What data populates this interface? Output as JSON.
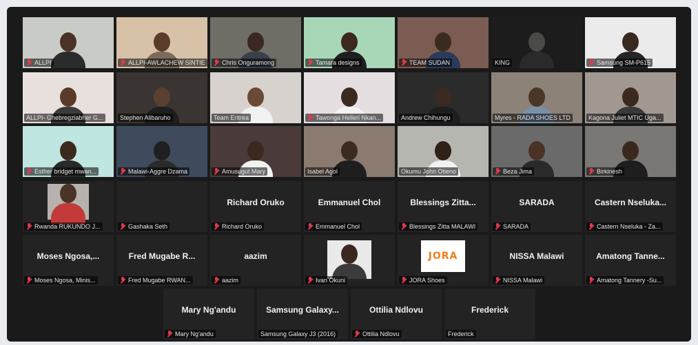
{
  "colors": {
    "active_border": "#e8e34a",
    "mic_muted": "#e2394b",
    "tile_bg": "#232323"
  },
  "rows": [
    {
      "tiles": [
        {
          "label": "ALLPI",
          "muted": true,
          "video": true,
          "bg": "#c9cbc7",
          "skin": "#4a3326",
          "shirt": "#2b2b2b"
        },
        {
          "label": "ALLPI-AWLACHEW SINTIE",
          "muted": true,
          "video": true,
          "bg": "#d7c2a7",
          "skin": "#5b3c2a",
          "shirt": "#7a6a5a"
        },
        {
          "label": "Chris Onguramong",
          "muted": true,
          "video": true,
          "bg": "#6e6e66",
          "skin": "#3b2820",
          "shirt": "#3a3f4c"
        },
        {
          "label": "Tamara designs",
          "muted": true,
          "video": true,
          "bg": "#a8d7b8",
          "skin": "#3c281e",
          "shirt": "#1f1f1f"
        },
        {
          "label": "TEAM SUDAN",
          "muted": true,
          "video": true,
          "bg": "#7a5c52",
          "skin": "#3a2a20",
          "shirt": "#2a3a5a"
        },
        {
          "label": "KING",
          "muted": false,
          "video": true,
          "active": true,
          "bg": "#1c1c1c",
          "skin": "#4a4a48",
          "shirt": "#2a2a2a"
        },
        {
          "label": "Samsung SM-P615",
          "muted": true,
          "video": true,
          "bg": "#ebebeb",
          "skin": "#3a2920",
          "shirt": "#262626"
        }
      ]
    },
    {
      "tiles": [
        {
          "label": "ALLPI- Ghebregziabher G...",
          "muted": false,
          "video": true,
          "bg": "#e8e0dc",
          "skin": "#5a3a2a",
          "shirt": "#3b3b3b"
        },
        {
          "label": "Stephen Alibaruho",
          "muted": false,
          "video": true,
          "bg": "#3a3432",
          "skin": "#5a4030",
          "shirt": "#1e1e1e"
        },
        {
          "label": "Team Eritrea",
          "muted": false,
          "video": true,
          "bg": "#d7d2cd",
          "skin": "#6b4a36",
          "shirt": "#f2f2f2"
        },
        {
          "label": "Tawonga Helleri Nkan...",
          "muted": true,
          "video": true,
          "bg": "#e6dfe2",
          "skin": "#3b2a20",
          "shirt": "#f2f2f2"
        },
        {
          "label": "Andrew Chihungu",
          "muted": false,
          "video": true,
          "bg": "#2b2b2b",
          "skin": "#3a2a22",
          "shirt": "#1e1e1e"
        },
        {
          "label": "Myres - RADA SHOES LTD",
          "muted": false,
          "video": true,
          "bg": "#8c8278",
          "skin": "#4a3527",
          "shirt": "#7a8faa"
        },
        {
          "label": "Kagona Juliet MTIC Uga...",
          "muted": false,
          "video": true,
          "bg": "#a29892",
          "skin": "#3c2a1e",
          "shirt": "#3a3a3a"
        }
      ]
    },
    {
      "tiles": [
        {
          "label": "Esther bridget mwan...",
          "muted": true,
          "video": true,
          "bg": "#bfe6e0",
          "skin": "#3b291e",
          "shirt": "#2a2a2a"
        },
        {
          "label": "Malawi-Aggre Dzama",
          "muted": true,
          "video": true,
          "bg": "#3f4b5c",
          "skin": "#1f1f1f",
          "shirt": "#2a2a2a"
        },
        {
          "label": "Amusugut Mary",
          "muted": true,
          "video": true,
          "bg": "#4a3a3a",
          "skin": "#3c281e",
          "shirt": "#f2f2f2"
        },
        {
          "label": "Isabel Agol",
          "muted": false,
          "video": true,
          "bg": "#8a7a70",
          "skin": "#3a2a20",
          "shirt": "#1e1e1e"
        },
        {
          "label": "Okumu John Otieno",
          "muted": false,
          "video": true,
          "bg": "#b6b6b0",
          "skin": "#2f2018",
          "shirt": "#f2f2f2"
        },
        {
          "label": "Beza Jima",
          "muted": true,
          "video": true,
          "bg": "#6a6a6a",
          "skin": "#4a3224",
          "shirt": "#2a2a2a"
        },
        {
          "label": "Birkinesh",
          "muted": true,
          "video": true,
          "bg": "#7a7875",
          "skin": "#3a281e",
          "shirt": "#1e1e1e"
        }
      ]
    },
    {
      "tiles": [
        {
          "label": "Rwanda RUKUNDO J...",
          "muted": true,
          "video": true,
          "small": true,
          "bg": "#b7b2ad",
          "skin": "#4a3426",
          "shirt": "#c23a3a"
        },
        {
          "label": "Gashaka Seth",
          "muted": true,
          "video": false,
          "name": ""
        },
        {
          "label": "Richard Oruko",
          "muted": true,
          "video": false,
          "name": "Richard Oruko"
        },
        {
          "label": "Emmanuel Chol",
          "muted": true,
          "video": false,
          "name": "Emmanuel Chol"
        },
        {
          "label": "Blessings Zitta MALAWI",
          "muted": true,
          "video": false,
          "name": "Blessings Zitta..."
        },
        {
          "label": "SARADA",
          "muted": true,
          "video": false,
          "name": "SARADA"
        },
        {
          "label": "Castern Nseluka - Za...",
          "muted": true,
          "video": false,
          "name": "Castern Nseluka..."
        }
      ]
    },
    {
      "tiles": [
        {
          "label": "Moses Ngosa, Minis...",
          "muted": true,
          "video": false,
          "name": "Moses Ngosa,..."
        },
        {
          "label": "Fred Mugabe RWAN...",
          "muted": true,
          "video": false,
          "name": "Fred Mugabe R..."
        },
        {
          "label": "aazim",
          "muted": true,
          "video": false,
          "name": "aazim"
        },
        {
          "label": "Ivan Okuni",
          "muted": true,
          "video": true,
          "photo": true,
          "bg": "#1a1a1a",
          "skin": "#3a2820",
          "shirt": "#3b3b3b"
        },
        {
          "label": "JORA Shoes",
          "muted": true,
          "video": true,
          "logo": "JORA"
        },
        {
          "label": "NISSA Malawi",
          "muted": true,
          "video": false,
          "name": "NISSA Malawi"
        },
        {
          "label": "Amatong Tannery -Su...",
          "muted": true,
          "video": false,
          "name": "Amatong Tanne..."
        }
      ]
    },
    {
      "tiles": [
        {
          "label": "Mary Ng'andu",
          "muted": true,
          "video": false,
          "name": "Mary Ng'andu"
        },
        {
          "label": "Samsung Galaxy J3 (2016)",
          "muted": false,
          "video": false,
          "name": "Samsung Galaxy..."
        },
        {
          "label": "Ottilia Ndlovu",
          "muted": true,
          "video": false,
          "name": "Ottilia Ndlovu"
        },
        {
          "label": "Frederick",
          "muted": false,
          "video": false,
          "name": "Frederick"
        }
      ]
    }
  ]
}
